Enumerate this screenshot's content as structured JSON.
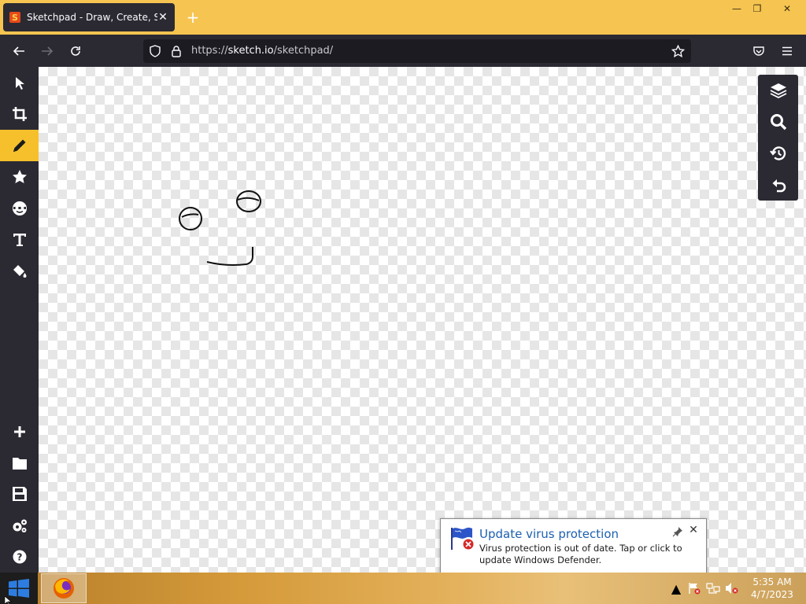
{
  "browser": {
    "tab_title": "Sketchpad - Draw, Create, Share!",
    "tab_close": "✕",
    "new_tab": "+",
    "url_prefix": "https://",
    "url_host": "sketch.io",
    "url_path": "/sketchpad/",
    "window_controls": {
      "minimize": "—",
      "restore": "❐",
      "close": "✕"
    }
  },
  "left_tools": [
    {
      "name": "select-tool",
      "icon": "arrow-pointer-icon",
      "active": false
    },
    {
      "name": "crop-tool",
      "icon": "crop-icon",
      "active": false
    },
    {
      "name": "pencil-tool",
      "icon": "pencil-icon",
      "active": true
    },
    {
      "name": "stamp-tool",
      "icon": "star-icon",
      "active": false
    },
    {
      "name": "emoji-tool",
      "icon": "face-icon",
      "active": false
    },
    {
      "name": "text-tool",
      "icon": "text-icon",
      "active": false
    },
    {
      "name": "fill-tool",
      "icon": "paint-bucket-icon",
      "active": false
    }
  ],
  "bottom_tools": [
    {
      "name": "new-button",
      "icon": "plus-icon"
    },
    {
      "name": "open-button",
      "icon": "folder-icon"
    },
    {
      "name": "save-button",
      "icon": "floppy-icon"
    },
    {
      "name": "settings-button",
      "icon": "gears-icon"
    },
    {
      "name": "help-button",
      "icon": "question-icon"
    }
  ],
  "right_tools": [
    {
      "name": "layers-button",
      "icon": "layers-icon"
    },
    {
      "name": "zoom-button",
      "icon": "magnifier-icon"
    },
    {
      "name": "history-button",
      "icon": "history-icon"
    },
    {
      "name": "undo-button",
      "icon": "undo-icon"
    }
  ],
  "notification": {
    "title": "Update virus protection",
    "body": "Virus protection is out of date. Tap or click to update Windows Defender.",
    "close": "✕"
  },
  "taskbar": {
    "time": "5:35 AM",
    "date": "4/7/2023",
    "tray_expand": "▲"
  },
  "colors": {
    "accent": "#f5c02b",
    "chrome": "#2b2a33",
    "tab_bar": "#f5c451",
    "notification_title": "#1c5fb0"
  }
}
